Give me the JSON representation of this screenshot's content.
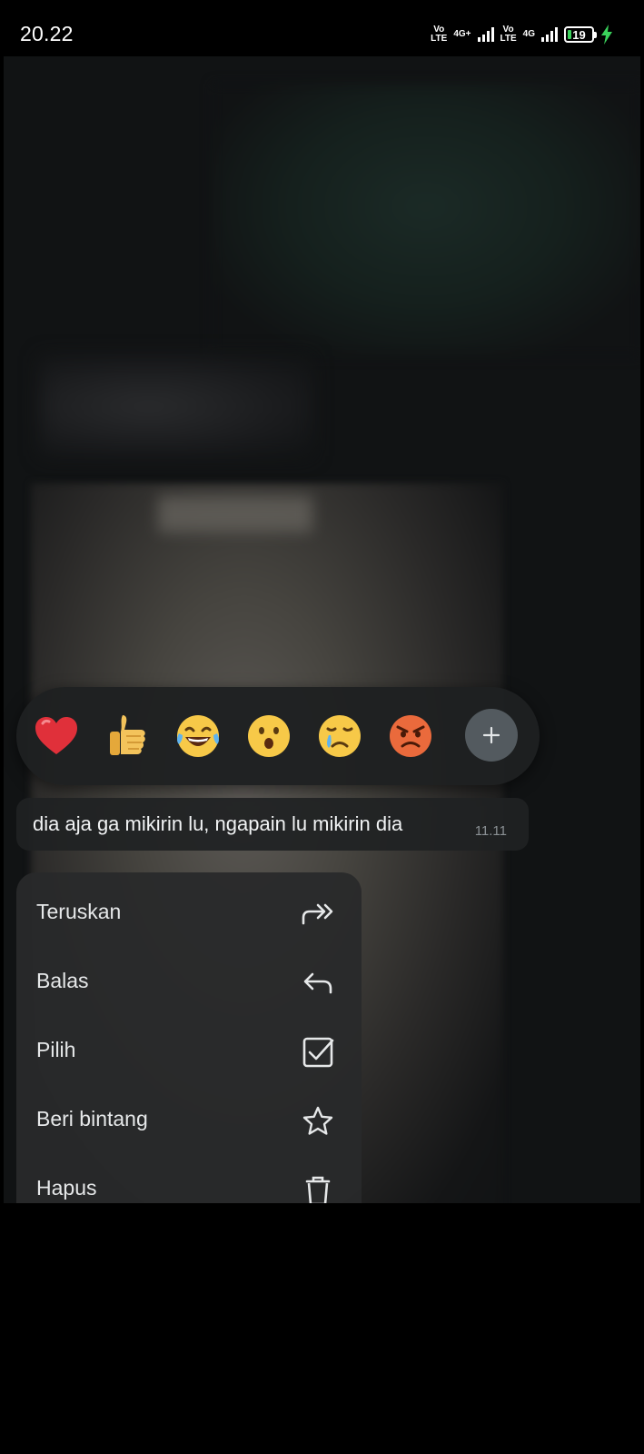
{
  "status_bar": {
    "time": "20.22",
    "sim1_top": "Vo",
    "sim1_bottom": "LTE",
    "net1": "4G+",
    "sim2_top": "Vo",
    "sim2_bottom": "LTE",
    "net2": "4G",
    "battery_percent": "19",
    "battery_charging": true,
    "charging_color": "#3ad15b"
  },
  "reactions": {
    "items": [
      {
        "name": "red-heart",
        "icon": "heart-emoji"
      },
      {
        "name": "thumbs-up",
        "icon": "thumbs-up-emoji"
      },
      {
        "name": "tears-of-joy",
        "icon": "laughing-emoji"
      },
      {
        "name": "surprised",
        "icon": "open-mouth-emoji"
      },
      {
        "name": "crying",
        "icon": "crying-emoji"
      },
      {
        "name": "angry",
        "icon": "angry-emoji"
      }
    ],
    "add_icon": "plus-icon"
  },
  "message": {
    "text": "dia aja ga mikirin lu, ngapain lu mikirin dia",
    "time": "11.11"
  },
  "menu": {
    "items": [
      {
        "label": "Teruskan",
        "icon": "forward-icon"
      },
      {
        "label": "Balas",
        "icon": "reply-icon"
      },
      {
        "label": "Pilih",
        "icon": "checkbox-icon"
      },
      {
        "label": "Beri bintang",
        "icon": "star-icon"
      },
      {
        "label": "Hapus",
        "icon": "trash-icon"
      }
    ]
  },
  "colors": {
    "background": "#000000",
    "panel": "#28292a",
    "text": "#e6e8e9",
    "muted": "#8a9094"
  }
}
